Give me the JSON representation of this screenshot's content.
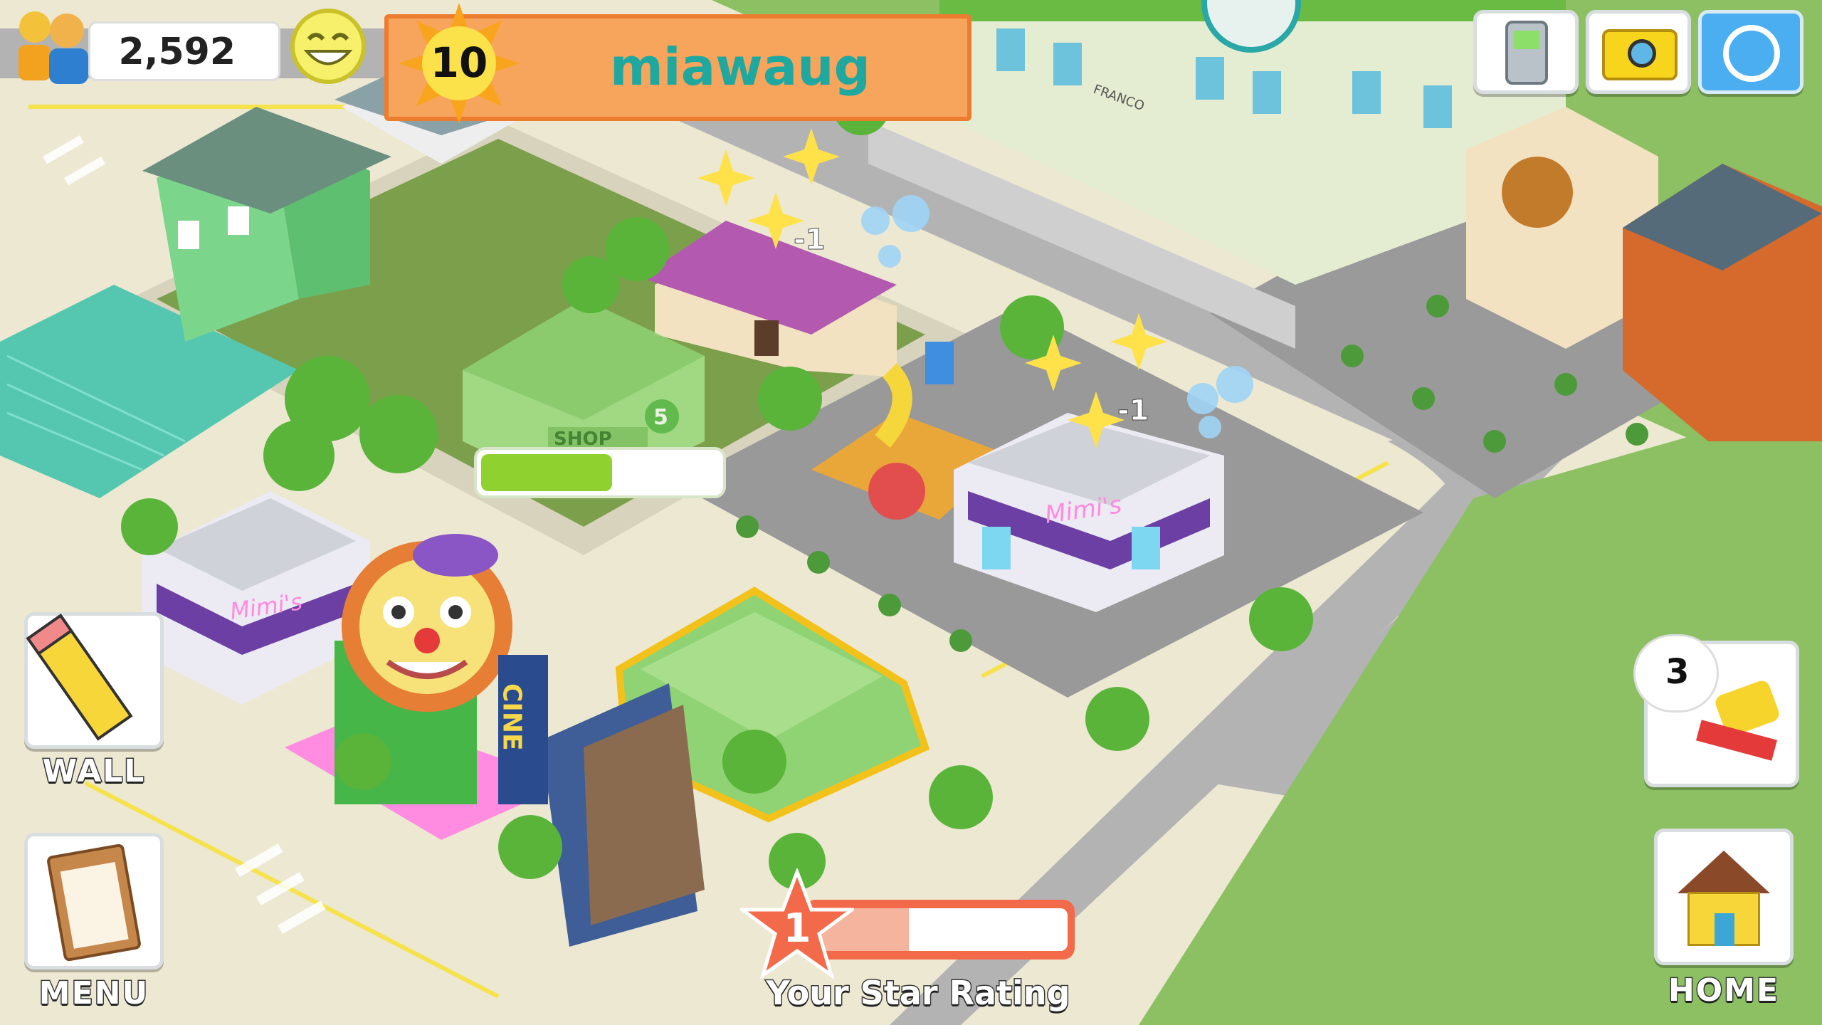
{
  "hud": {
    "population": "2,592",
    "level": "10",
    "player_name": "miawaug",
    "happiness_icon": "smiley-face-icon",
    "population_icon": "people-icon",
    "top_right_buttons": [
      {
        "name": "phone-button",
        "icon": "mobile-phone-icon"
      },
      {
        "name": "camera-button",
        "icon": "camera-icon"
      },
      {
        "name": "refresh-button",
        "icon": "refresh-icon"
      }
    ]
  },
  "left_buttons": {
    "wall_label": "WALL",
    "menu_label": "MENU"
  },
  "right_buttons": {
    "cleanup_count": "3",
    "home_label": "HOME"
  },
  "star_rating": {
    "value": "1",
    "label": "Your Star Rating",
    "progress": 0.38
  },
  "world": {
    "shop_sign": "SHOP",
    "shop_number": "5",
    "boutique_sign": "Mimi's",
    "boutique_sign_2": "Mimi's",
    "cinema_sign": "CINE",
    "factory_sign": "FRANCO",
    "float_text_1": "-1",
    "float_text_2": "-1",
    "construction_progress": 0.55
  },
  "colors": {
    "level_banner": "#f7a45c",
    "name_text": "#1fa8a0",
    "grass": "#8cc063",
    "road": "#a9a9a9",
    "sidewalk": "#f4f1e0",
    "progress_green": "#8fd12f",
    "star_orange": "#f26a4a"
  }
}
